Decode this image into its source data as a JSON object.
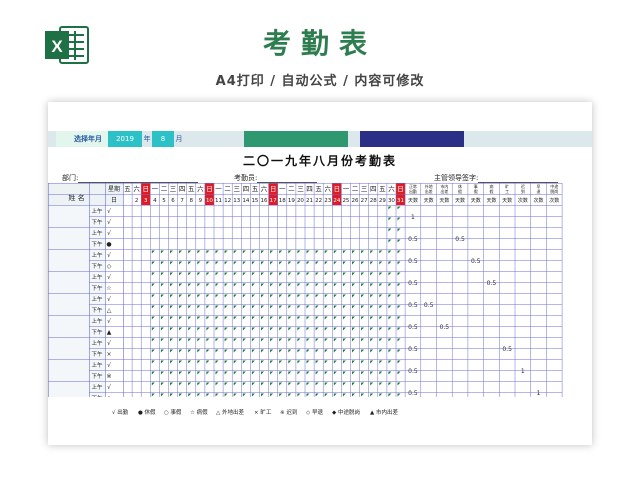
{
  "header": {
    "title": "考勤表",
    "subtitle": "A4打印 / 自动公式 / 内容可修改",
    "logo_letter": "X"
  },
  "selector": {
    "label": "选择年月",
    "year": "2019",
    "year_unit": "年",
    "month": "8",
    "month_unit": "月"
  },
  "sheet": {
    "title": "二〇一九年八月份考勤表",
    "dept_label": "部门:",
    "clerk_label": "考勤员:",
    "leader_label": "主管领导签字:"
  },
  "table": {
    "name_header": "姓 名",
    "week_label": "星期",
    "day_label": "日",
    "weekdays": [
      "五",
      "六",
      "日",
      "一",
      "二",
      "三",
      "四",
      "五",
      "六",
      "日",
      "一",
      "二",
      "三",
      "四",
      "五",
      "六",
      "日",
      "一",
      "二",
      "三",
      "四",
      "五",
      "六",
      "日",
      "一",
      "二",
      "三",
      "四",
      "五",
      "六",
      "日"
    ],
    "days": [
      "2",
      "3",
      "4",
      "5",
      "6",
      "7",
      "8",
      "9",
      "10",
      "11",
      "12",
      "13",
      "14",
      "15",
      "16",
      "17",
      "18",
      "19",
      "20",
      "21",
      "22",
      "23",
      "24",
      "25",
      "26",
      "27",
      "28",
      "29",
      "30",
      "31"
    ],
    "red_days": [
      "4",
      "11",
      "18",
      "25"
    ],
    "summary_headers": [
      {
        "top": "正常出勤",
        "unit": "天数"
      },
      {
        "top": "外地出差",
        "unit": "天数"
      },
      {
        "top": "市内出差",
        "unit": "天数"
      },
      {
        "top": "休假",
        "unit": "天数"
      },
      {
        "top": "事假",
        "unit": "天数"
      },
      {
        "top": "病假",
        "unit": "天数"
      },
      {
        "top": "旷工",
        "unit": "天数"
      },
      {
        "top": "迟到",
        "unit": "次数"
      },
      {
        "top": "早退",
        "unit": "次数"
      },
      {
        "top": "中途脱岗",
        "unit": "次数"
      }
    ],
    "am_label": "上午",
    "pm_label": "下午",
    "employees": [
      {
        "am": "√",
        "pm": "√",
        "summary": [
          "1",
          "",
          "",
          "",
          "",
          "",
          "",
          "",
          "",
          ""
        ]
      },
      {
        "am": "√",
        "pm": "●",
        "summary": [
          "0.5",
          "",
          "",
          "0.5",
          "",
          "",
          "",
          "",
          "",
          ""
        ]
      },
      {
        "am": "√",
        "pm": "◇",
        "summary": [
          "0.5",
          "",
          "",
          "",
          "0.5",
          "",
          "",
          "",
          "",
          ""
        ]
      },
      {
        "am": "√",
        "pm": "☆",
        "summary": [
          "0.5",
          "",
          "",
          "",
          "",
          "0.5",
          "",
          "",
          "",
          ""
        ]
      },
      {
        "am": "√",
        "pm": "△",
        "summary": [
          "0.5",
          "0.5",
          "",
          "",
          "",
          "",
          "",
          "",
          "",
          ""
        ]
      },
      {
        "am": "√",
        "pm": "▲",
        "summary": [
          "0.5",
          "",
          "0.5",
          "",
          "",
          "",
          "",
          "",
          "",
          ""
        ]
      },
      {
        "am": "√",
        "pm": "×",
        "summary": [
          "0.5",
          "",
          "",
          "",
          "",
          "",
          "0.5",
          "",
          "",
          ""
        ]
      },
      {
        "am": "√",
        "pm": "※",
        "summary": [
          "0.5",
          "",
          "",
          "",
          "",
          "",
          "",
          "1",
          "",
          ""
        ]
      },
      {
        "am": "√",
        "pm": "◇",
        "summary": [
          "0.5",
          "",
          "",
          "",
          "",
          "",
          "",
          "",
          "1",
          ""
        ]
      }
    ]
  },
  "legend": [
    {
      "symbol": "√",
      "label": "出勤"
    },
    {
      "symbol": "●",
      "label": "休假"
    },
    {
      "symbol": "○",
      "label": "事假"
    },
    {
      "symbol": "☆",
      "label": "病假"
    },
    {
      "symbol": "△",
      "label": "外地出差"
    },
    {
      "symbol": "×",
      "label": "旷工"
    },
    {
      "symbol": "※",
      "label": "迟到"
    },
    {
      "symbol": "◇",
      "label": "早退"
    },
    {
      "symbol": "◆",
      "label": "中途脱岗"
    },
    {
      "symbol": "▲",
      "label": "市内出差"
    }
  ],
  "colors": {
    "brand_green": "#2d7d4f",
    "excel_green": "#1e7145",
    "holiday_red": "#e01b24",
    "selector_cyan": "#2cc1c7",
    "bar_green": "#2e9970",
    "bar_navy": "#2c2f86",
    "grid_line": "#6d6fd0",
    "marker_green": "#1f7a3a"
  }
}
